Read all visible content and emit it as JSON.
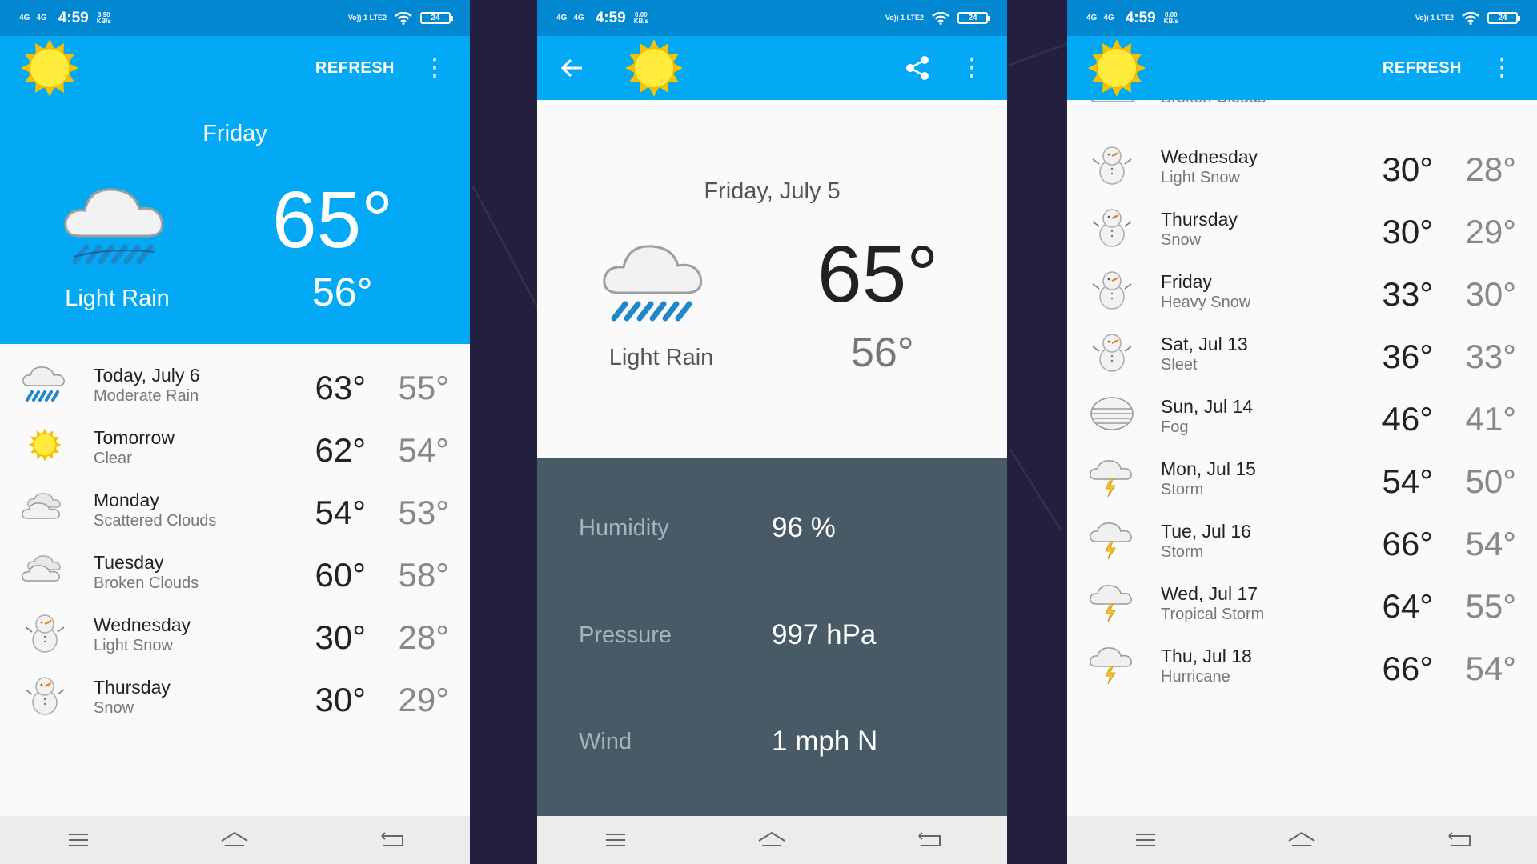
{
  "statusbar": {
    "network_left": "4G",
    "network_right": "4G",
    "time": "4:59",
    "speed_p1": "3.90",
    "speed_p2": "0.00",
    "speed_p3": "0.00",
    "speed_unit": "KB/s",
    "volte": "Vo)) 1 LTE2",
    "battery": "24"
  },
  "phone1": {
    "appbar": {
      "refresh_label": "REFRESH",
      "overflow": "⋮"
    },
    "hero": {
      "day": "Friday",
      "desc": "Light Rain",
      "high": "65°",
      "low": "56°"
    },
    "forecast": [
      {
        "day": "Today, July 6",
        "desc": "Moderate Rain",
        "high": "63°",
        "low": "55°",
        "icon": "rain-icon"
      },
      {
        "day": "Tomorrow",
        "desc": "Clear",
        "high": "62°",
        "low": "54°",
        "icon": "sun-icon"
      },
      {
        "day": "Monday",
        "desc": "Scattered Clouds",
        "high": "54°",
        "low": "53°",
        "icon": "clouds-icon"
      },
      {
        "day": "Tuesday",
        "desc": "Broken Clouds",
        "high": "60°",
        "low": "58°",
        "icon": "clouds-icon"
      },
      {
        "day": "Wednesday",
        "desc": "Light Snow",
        "high": "30°",
        "low": "28°",
        "icon": "snowman-icon"
      },
      {
        "day": "Thursday",
        "desc": "Snow",
        "high": "30°",
        "low": "29°",
        "icon": "snowman-icon"
      }
    ]
  },
  "phone2": {
    "appbar": {
      "overflow": "⋮"
    },
    "date": "Friday, July 5",
    "desc": "Light Rain",
    "high": "65°",
    "low": "56°",
    "details": [
      {
        "label": "Humidity",
        "value": "96 %"
      },
      {
        "label": "Pressure",
        "value": "997 hPa"
      },
      {
        "label": "Wind",
        "value": "1 mph N"
      }
    ]
  },
  "phone3": {
    "appbar": {
      "refresh_label": "REFRESH",
      "overflow": "⋮"
    },
    "partial": {
      "desc": "Broken Clouds"
    },
    "forecast": [
      {
        "day": "Wednesday",
        "desc": "Light Snow",
        "high": "30°",
        "low": "28°",
        "icon": "snowman-icon"
      },
      {
        "day": "Thursday",
        "desc": "Snow",
        "high": "30°",
        "low": "29°",
        "icon": "snowman-icon"
      },
      {
        "day": "Friday",
        "desc": "Heavy Snow",
        "high": "33°",
        "low": "30°",
        "icon": "snowman-icon"
      },
      {
        "day": "Sat, Jul 13",
        "desc": "Sleet",
        "high": "36°",
        "low": "33°",
        "icon": "snowman-icon"
      },
      {
        "day": "Sun, Jul 14",
        "desc": "Fog",
        "high": "46°",
        "low": "41°",
        "icon": "fog-icon"
      },
      {
        "day": "Mon, Jul 15",
        "desc": "Storm",
        "high": "54°",
        "low": "50°",
        "icon": "storm-icon"
      },
      {
        "day": "Tue, Jul 16",
        "desc": "Storm",
        "high": "66°",
        "low": "54°",
        "icon": "storm-icon"
      },
      {
        "day": "Wed, Jul 17",
        "desc": "Tropical Storm",
        "high": "64°",
        "low": "55°",
        "icon": "storm-icon"
      },
      {
        "day": "Thu, Jul 18",
        "desc": "Hurricane",
        "high": "66°",
        "low": "54°",
        "icon": "storm-icon"
      }
    ]
  },
  "colors": {
    "primary": "#03a9f4",
    "primary_dark": "#0288d1",
    "detail_panel": "#475a66",
    "background": "#231f3f"
  }
}
